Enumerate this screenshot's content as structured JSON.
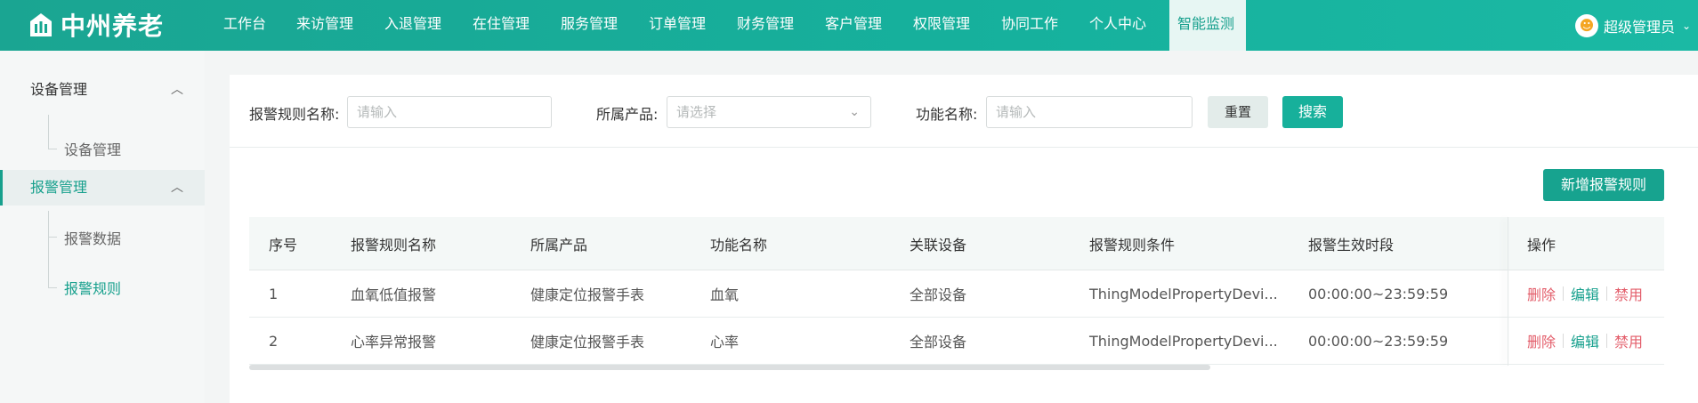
{
  "app": {
    "logo_text": "中州养老"
  },
  "nav": {
    "items": [
      "工作台",
      "来访管理",
      "入退管理",
      "在住管理",
      "服务管理",
      "订单管理",
      "财务管理",
      "客户管理",
      "权限管理",
      "协同工作",
      "个人中心",
      "智能监测"
    ],
    "active_index": 11
  },
  "user": {
    "name": "超级管理员"
  },
  "sidebar": {
    "group1": {
      "label": "设备管理",
      "sub": "设备管理"
    },
    "group2": {
      "label": "报警管理",
      "sub1": "报警数据",
      "sub2": "报警规则"
    }
  },
  "search": {
    "rule_name_label": "报警规则名称:",
    "rule_name_placeholder": "请输入",
    "product_label": "所属产品:",
    "product_placeholder": "请选择",
    "function_label": "功能名称:",
    "function_placeholder": "请输入",
    "reset": "重置",
    "search": "搜索"
  },
  "actions": {
    "add": "新增报警规则"
  },
  "table": {
    "headers": [
      "序号",
      "报警规则名称",
      "所属产品",
      "功能名称",
      "关联设备",
      "报警规则条件",
      "报警生效时段",
      "操作"
    ],
    "rows": [
      {
        "no": "1",
        "name": "血氧低值报警",
        "product": "健康定位报警手表",
        "function": "血氧",
        "device": "全部设备",
        "condition": "ThingModelPropertyDevi...",
        "period": "00:00:00~23:59:59"
      },
      {
        "no": "2",
        "name": "心率异常报警",
        "product": "健康定位报警手表",
        "function": "心率",
        "device": "全部设备",
        "condition": "ThingModelPropertyDevi...",
        "period": "00:00:00~23:59:59"
      }
    ],
    "ops": {
      "delete": "删除",
      "edit": "编辑",
      "disable": "禁用"
    }
  },
  "colors": {
    "primary": "#17a08d",
    "danger": "#e35d6a"
  }
}
